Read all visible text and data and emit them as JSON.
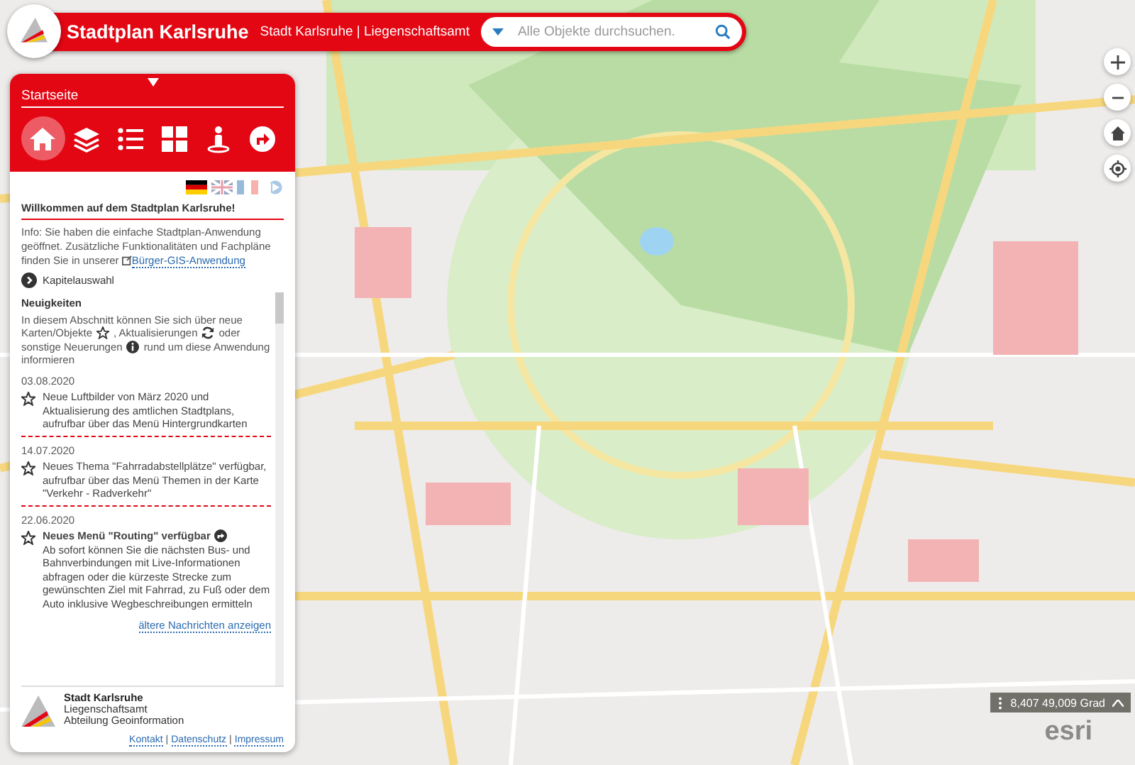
{
  "header": {
    "title": "Stadtplan Karlsruhe",
    "subtitle": "Stadt Karlsruhe | Liegenschaftsamt",
    "search": {
      "placeholder": "Alle Objekte durchsuchen."
    }
  },
  "panel": {
    "title": "Startseite",
    "nav_items": [
      {
        "kind": "home",
        "selected": true
      },
      {
        "kind": "layers",
        "selected": false
      },
      {
        "kind": "list",
        "selected": false
      },
      {
        "kind": "grid",
        "selected": false
      },
      {
        "kind": "person",
        "selected": false
      },
      {
        "kind": "route",
        "selected": false
      }
    ],
    "languages": [
      {
        "kind": "de",
        "selected": true
      },
      {
        "kind": "en",
        "selected": false
      },
      {
        "kind": "fr",
        "selected": false
      },
      {
        "kind": "threed",
        "selected": false
      }
    ],
    "welcome": "Willkommen auf dem Stadtplan Karlsruhe!",
    "info": {
      "text": "Info: Sie haben die einfache Stadtplan-Anwendung geöffnet. Zusätzliche Funktionalitäten und Fachpläne finden Sie in unserer",
      "link": "Bürger-GIS-Anwendung"
    },
    "chapter": "Kapitelauswahl",
    "news": {
      "heading": "Neuigkeiten",
      "intro": [
        [
          {
            "kind": "text",
            "text": "In diesem Abschnitt können Sie sich über neue"
          }
        ],
        [
          {
            "kind": "text",
            "text": "Karten/Objekte"
          },
          {
            "kind": "star"
          },
          {
            "kind": "text",
            "text": ", Aktualisierungen"
          },
          {
            "kind": "refresh"
          },
          {
            "kind": "text",
            "text": "oder"
          }
        ],
        [
          {
            "kind": "text",
            "text": "sonstige Neuerungen"
          },
          {
            "kind": "info"
          },
          {
            "kind": "text",
            "text": "rund um diese Anwendung"
          }
        ],
        [
          {
            "kind": "text",
            "text": "informieren"
          }
        ]
      ],
      "items": [
        {
          "date": "03.08.2020",
          "text": "Neue Luftbilder von März 2020 und Aktualisierung des amtlichen Stadtplans, aufrufbar über das Menü Hintergrundkarten"
        },
        {
          "date": "14.07.2020",
          "text": "Neues Thema \"Fahrradabstellplätze\" verfügbar, aufrufbar über das Menü Themen in der Karte \"Verkehr - Radverkehr\""
        },
        {
          "date": "22.06.2020",
          "title": "Neues Menü \"Routing\" verfügbar",
          "text": "Ab sofort können Sie die nächsten Bus- und Bahnverbindungen mit Live-Informationen abfragen oder die kürzeste Strecke zum gewünschten Ziel mit Fahrrad, zu Fuß oder dem Auto inklusive Wegbeschreibungen ermitteln"
        }
      ],
      "more": "ältere Nachrichten anzeigen"
    },
    "footer": {
      "org": [
        "Stadt Karlsruhe",
        "Liegenschaftsamt",
        "Abteilung Geoinformation"
      ],
      "links": [
        "Kontakt",
        "Datenschutz",
        "Impressum"
      ],
      "separator": "|"
    }
  },
  "map": {
    "controls": [
      {
        "kind": "zoom-in"
      },
      {
        "kind": "zoom-out"
      },
      {
        "kind": "home"
      },
      {
        "kind": "locate"
      }
    ],
    "coordinates": "8,407 49,009 Grad",
    "attribution": "esri"
  }
}
